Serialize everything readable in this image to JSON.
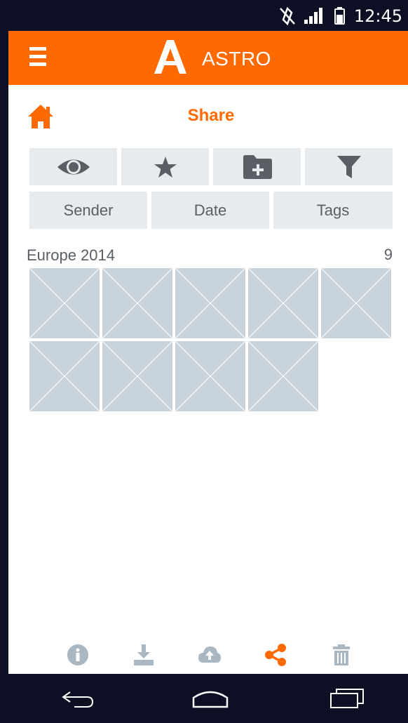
{
  "status_bar": {
    "time": "12:45",
    "icons": [
      "mute-icon",
      "signal-icon",
      "battery-icon"
    ]
  },
  "app_bar": {
    "title": "ASTRO",
    "menu_icon": "hamburger-menu-icon",
    "logo": "astro-logo"
  },
  "page": {
    "title": "Share",
    "home_icon": "home-icon"
  },
  "toolbar": {
    "buttons": [
      "eye-icon",
      "star-icon",
      "add-folder-icon",
      "filter-icon"
    ]
  },
  "sort": {
    "buttons": [
      "Sender",
      "Date",
      "Tags"
    ]
  },
  "album": {
    "name": "Europe 2014",
    "count": "9",
    "thumbnails": 9
  },
  "actions": {
    "items": [
      "info-icon",
      "download-icon",
      "upload-cloud-icon",
      "share-icon",
      "trash-icon"
    ],
    "active": "share-icon"
  },
  "nav_bar": {
    "items": [
      "back-icon",
      "home-nav-icon",
      "recents-icon"
    ]
  },
  "colors": {
    "accent": "#ff6a00",
    "status_bar": "#0d0f24",
    "button_bg": "#e8ebee",
    "thumbnail": "#c7d2da",
    "icon_gray": "#5a5f66",
    "icon_muted": "#a9b7c2"
  }
}
